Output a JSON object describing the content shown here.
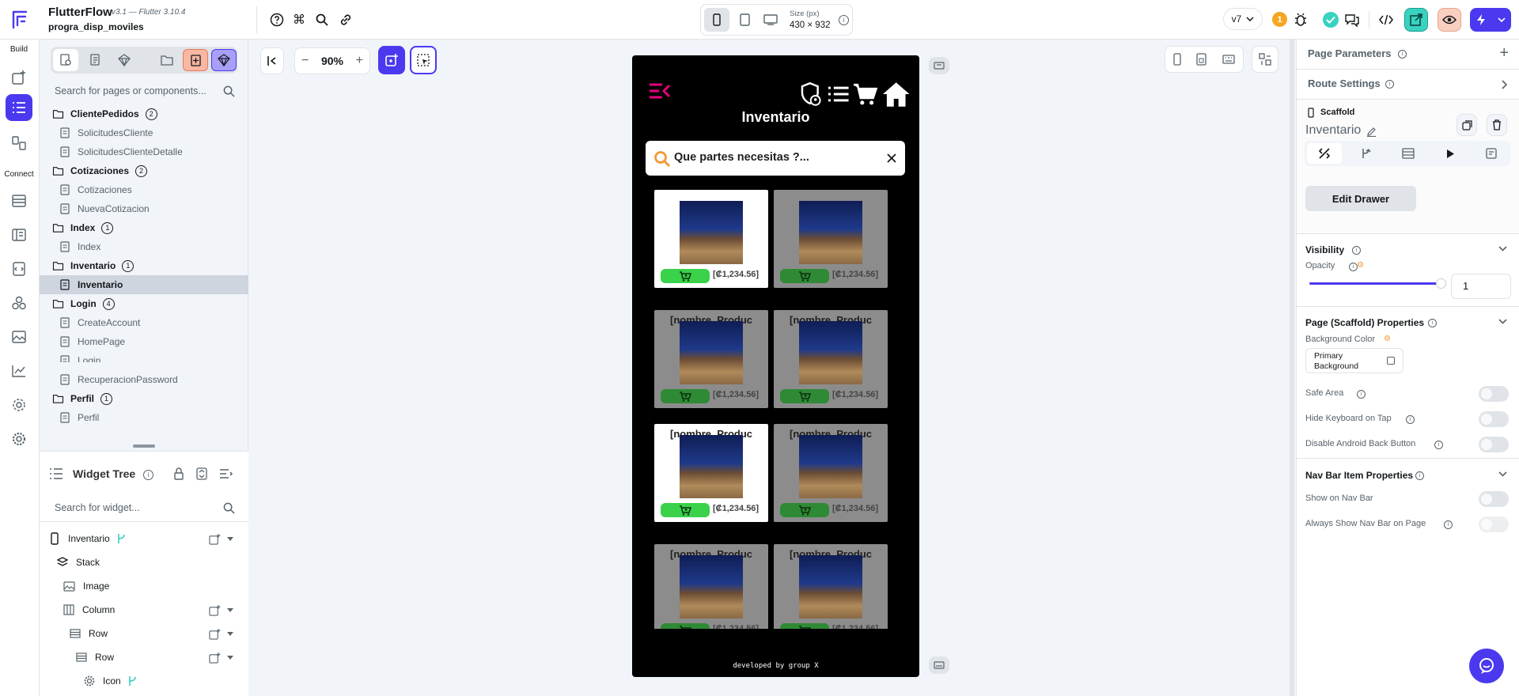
{
  "app": {
    "name": "FlutterFlow",
    "version": "v3.1 — Flutter 3.10.4",
    "project": "progra_disp_moviles"
  },
  "topbar": {
    "size_label": "Size (px)",
    "size_value": "430 × 932",
    "version_select": "v7",
    "notification_count": "1"
  },
  "rail": {
    "build_label": "Build",
    "connect_label": "Connect"
  },
  "left": {
    "search_placeholder": "Search for pages or components...",
    "tree": [
      {
        "type": "folder",
        "label": "ClientePedidos",
        "count": "2"
      },
      {
        "type": "page",
        "label": "SolicitudesCliente"
      },
      {
        "type": "page",
        "label": "SolicitudesClienteDetalle"
      },
      {
        "type": "folder",
        "label": "Cotizaciones",
        "count": "2"
      },
      {
        "type": "page",
        "label": "Cotizaciones"
      },
      {
        "type": "page",
        "label": "NuevaCotizacion"
      },
      {
        "type": "folder",
        "label": "Index",
        "count": "1"
      },
      {
        "type": "page",
        "label": "Index"
      },
      {
        "type": "folder",
        "label": "Inventario",
        "count": "1"
      },
      {
        "type": "page",
        "label": "Inventario",
        "selected": true
      },
      {
        "type": "folder",
        "label": "Login",
        "count": "4"
      },
      {
        "type": "page",
        "label": "CreateAccount"
      },
      {
        "type": "page",
        "label": "HomePage"
      },
      {
        "type": "page",
        "label": "Login"
      },
      {
        "type": "page",
        "label": "RecuperacionPassword"
      },
      {
        "type": "folder",
        "label": "Perfil",
        "count": "1"
      },
      {
        "type": "page",
        "label": "Perfil"
      }
    ],
    "widget_tree_title": "Widget Tree",
    "widget_search_placeholder": "Search for widget...",
    "widgets": [
      {
        "label": "Inventario",
        "icon": "phone-icon"
      },
      {
        "label": "Stack",
        "icon": "stack-icon"
      },
      {
        "label": "Image",
        "icon": "image-icon"
      },
      {
        "label": "Column",
        "icon": "column-icon"
      },
      {
        "label": "Row",
        "icon": "row-icon"
      },
      {
        "label": "Row",
        "icon": "row-icon"
      },
      {
        "label": "Icon",
        "icon": "settings-icon"
      }
    ]
  },
  "canvas": {
    "zoom": "90%"
  },
  "phone": {
    "title": "Inventario",
    "search_text": "Que partes necesitas ?...",
    "product_name": "[nombre_Produc",
    "price": "[₡1,234.56]",
    "footer": "developed by group X"
  },
  "right": {
    "page_parameters": "Page Parameters",
    "route_settings": "Route Settings",
    "scaffold_label": "Scaffold",
    "page_name": "Inventario",
    "edit_drawer": "Edit Drawer",
    "visibility": "Visibility",
    "opacity_label": "Opacity",
    "opacity_value": "1",
    "opacity_fraction": 0.97,
    "page_props": "Page (Scaffold) Properties",
    "bg_color_label": "Background Color",
    "bg_color_value": "Primary Background",
    "safe_area": "Safe Area",
    "hide_keyboard": "Hide Keyboard on Tap",
    "disable_back": "Disable Android Back Button",
    "nav_props": "Nav Bar Item Properties",
    "show_nav": "Show on Nav Bar",
    "always_nav": "Always Show Nav Bar on Page"
  },
  "colors": {
    "accent": "#4b39ef",
    "pink": "#e5007e",
    "green": "#39d24a",
    "teal": "#39d2c0"
  }
}
